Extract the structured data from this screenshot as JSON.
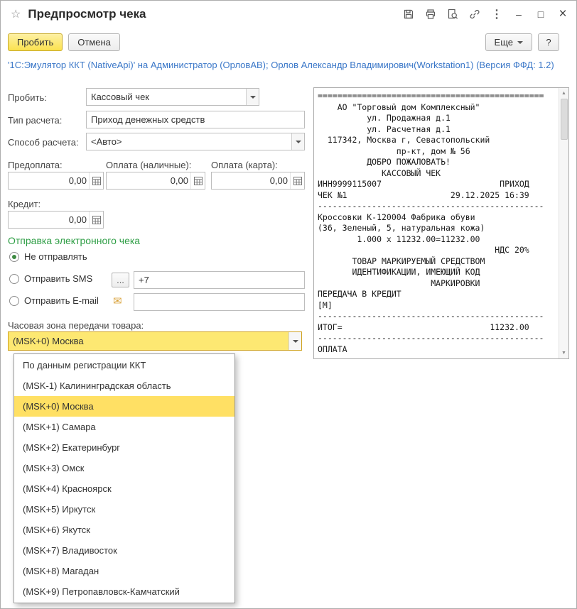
{
  "window": {
    "title": "Предпросмотр чека",
    "info": "'1С:Эмулятор ККТ (NativeApi)' на Администратор (ОрловАВ); Орлов Александр Владимирович(Workstation1) (Версия ФФД: 1.2)"
  },
  "toolbar": {
    "commit": "Пробить",
    "cancel": "Отмена",
    "more": "Еще",
    "help": "?"
  },
  "icons": {
    "star": "☆",
    "more_vert": "⋮",
    "minimize": "–",
    "maximize": "□",
    "close": "×",
    "ellipsis": "...",
    "envelope": "✉",
    "scroll_up": "▲",
    "scroll_down": "▼"
  },
  "form": {
    "operation": {
      "label": "Пробить:",
      "value": "Кассовый чек"
    },
    "calc_type": {
      "label": "Тип расчета:",
      "value": "Приход денежных средств"
    },
    "calc_method": {
      "label": "Способ расчета:",
      "value": "<Авто>"
    },
    "prepayment": {
      "label": "Предоплата:",
      "value": "0,00"
    },
    "payment_cash": {
      "label": "Оплата (наличные):",
      "value": "0,00"
    },
    "payment_card": {
      "label": "Оплата (карта):",
      "value": "0,00"
    },
    "credit": {
      "label": "Кредит:",
      "value": "0,00"
    },
    "eticket": {
      "title": "Отправка электронного чека",
      "option_none": "Не отправлять",
      "option_sms": "Отправить SMS",
      "sms_value": "+7",
      "option_email": "Отправить E-mail",
      "email_value": "",
      "selected": "Не отправлять"
    },
    "timezone": {
      "label": "Часовая зона передачи товара:",
      "value": "(MSK+0) Москва"
    }
  },
  "timezone_dropdown": {
    "selected_index": 2,
    "items": [
      "По данным регистрации ККТ",
      "(MSK-1) Калининградская область",
      "(MSK+0) Москва",
      "(MSK+1) Самара",
      "(MSK+2) Екатеринбург",
      "(MSK+3) Омск",
      "(MSK+4) Красноярск",
      "(MSK+5) Иркутск",
      "(MSK+6) Якутск",
      "(MSK+7) Владивосток",
      "(MSK+8) Магадан",
      "(MSK+9) Петропавловск-Камчатский"
    ]
  },
  "receipt": {
    "lines": [
      "==============================================",
      "    АО \"Торговый дом Комплексный\"",
      "          ул. Продажная д.1",
      "          ул. Расчетная д.1",
      "  117342, Москва г, Севастопольский",
      "                пр-кт, дом № 56",
      "          ДОБРО ПОЖАЛОВАТЬ!",
      "             КАССОВЫЙ ЧЕК",
      "ИНН9999115007                        ПРИХОД",
      "ЧЕК №1                     29.12.2025 16:39",
      "----------------------------------------------",
      "Кроссовки К-120004 Фабрика обуви",
      "(36, Зеленый, 5, натуральная кожа)",
      "        1.000 x 11232.00=11232.00",
      "                                    НДС 20%",
      "       ТОВАР МАРКИРУЕМЫЙ СРЕДСТВОМ",
      "       ИДЕНТИФИКАЦИИ, ИМЕЮЩИЙ КОД",
      "                       МАРКИРОВКИ",
      "ПЕРЕДАЧА В КРЕДИТ",
      "[М]",
      "----------------------------------------------",
      "ИТОГ=                              11232.00",
      "----------------------------------------------",
      "ОПЛАТА"
    ]
  },
  "colors": {
    "accent_yellow": "#fbe24f",
    "selection_yellow": "#ffe064",
    "link_blue": "#3a77c8",
    "group_green": "#2e9e45"
  }
}
